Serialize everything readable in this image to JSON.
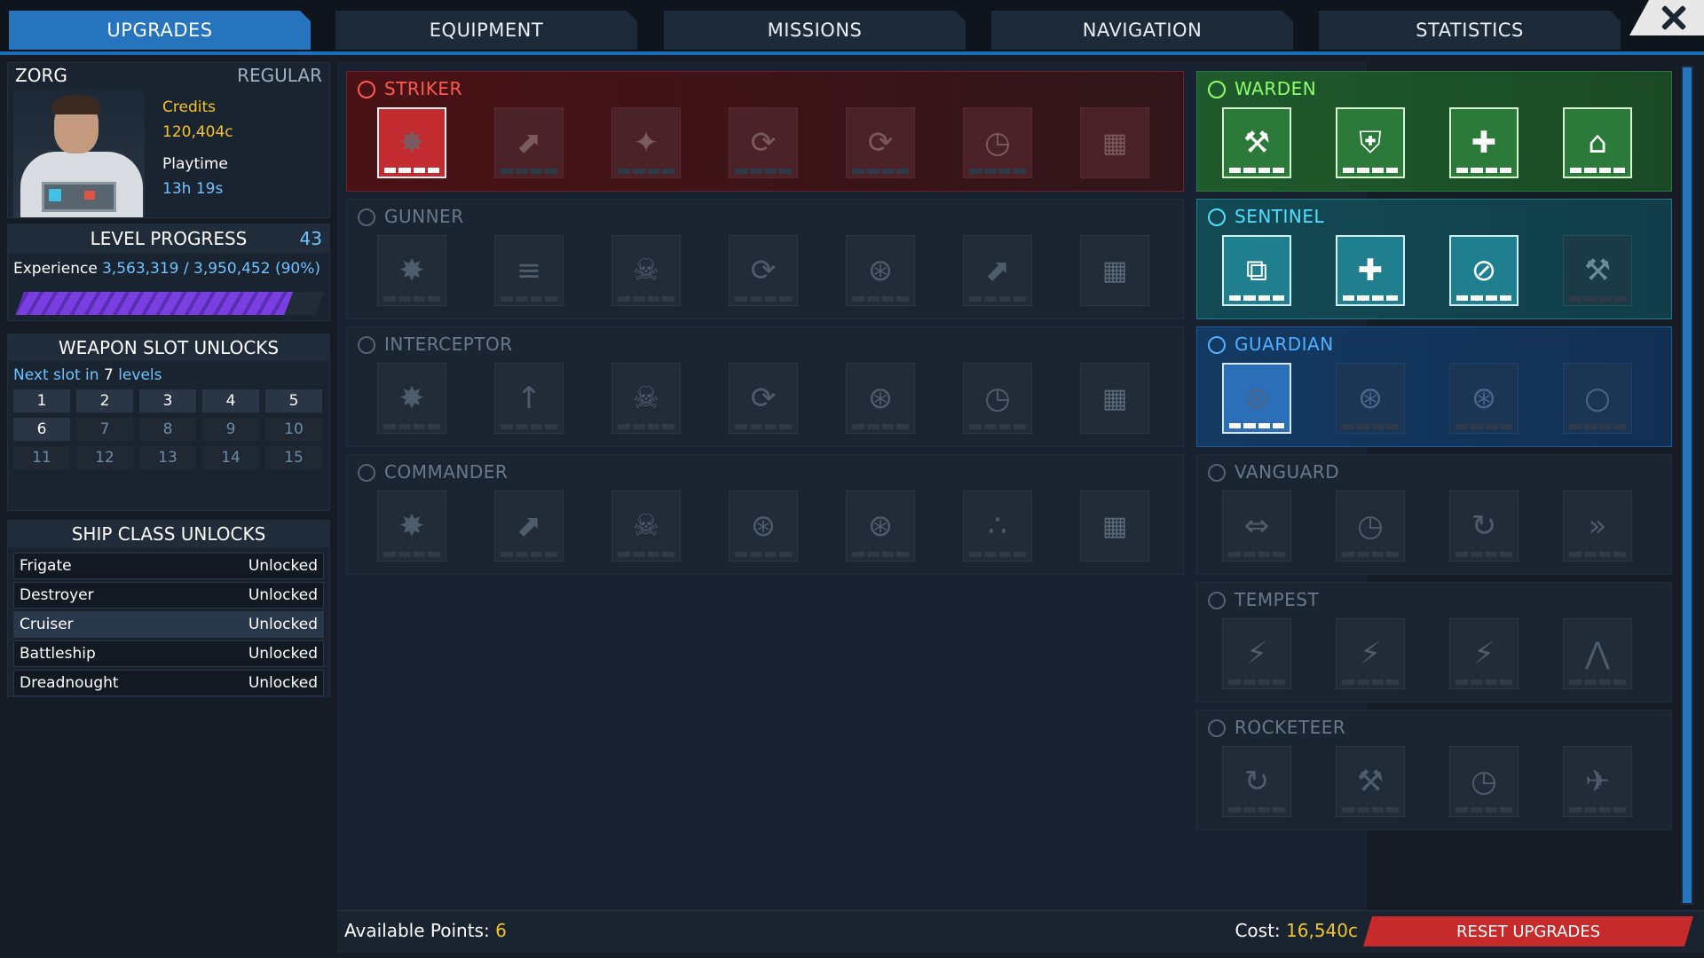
{
  "tabs": [
    "UPGRADES",
    "EQUIPMENT",
    "MISSIONS",
    "NAVIGATION",
    "STATISTICS"
  ],
  "profile": {
    "name": "ZORG",
    "rank": "REGULAR",
    "credits_label": "Credits",
    "credits_value": "120,404c",
    "playtime_label": "Playtime",
    "playtime_value": "13h 19s"
  },
  "level_progress": {
    "title": "LEVEL PROGRESS",
    "level": "43",
    "exp_label": "Experience",
    "exp_value": "3,563,319 / 3,950,452 (90%)",
    "percent": 90
  },
  "weapon_slots": {
    "title": "WEAPON SLOT UNLOCKS",
    "next_prefix": "Next slot in ",
    "next_value": "7",
    "next_suffix": " levels",
    "slots": [
      "1",
      "2",
      "3",
      "4",
      "5",
      "6",
      "7",
      "8",
      "9",
      "10",
      "11",
      "12",
      "13",
      "14",
      "15"
    ],
    "unlocked": 6
  },
  "ship_classes": {
    "title": "SHIP CLASS UNLOCKS",
    "items": [
      {
        "name": "Frigate",
        "status": "Unlocked"
      },
      {
        "name": "Destroyer",
        "status": "Unlocked"
      },
      {
        "name": "Cruiser",
        "status": "Unlocked"
      },
      {
        "name": "Battleship",
        "status": "Unlocked"
      },
      {
        "name": "Dreadnought",
        "status": "Unlocked"
      }
    ]
  },
  "trees_left": [
    {
      "title": "STRIKER",
      "theme": "red",
      "skills": [
        "✸",
        "⬈",
        "✦",
        "⟳",
        "⟳",
        "◷",
        "▦"
      ],
      "active": [
        0
      ]
    },
    {
      "title": "GUNNER",
      "theme": "gray",
      "skills": [
        "✸",
        "≡",
        "☠",
        "⟳",
        "⊛",
        "⬈",
        "▦"
      ],
      "active": []
    },
    {
      "title": "INTERCEPTOR",
      "theme": "gray",
      "skills": [
        "✸",
        "↑",
        "☠",
        "⟳",
        "⊛",
        "◷",
        "▦"
      ],
      "active": []
    },
    {
      "title": "COMMANDER",
      "theme": "gray",
      "skills": [
        "✸",
        "⬈",
        "☠",
        "⊛",
        "⊛",
        "∴",
        "▦"
      ],
      "active": []
    }
  ],
  "trees_right": [
    {
      "title": "WARDEN",
      "theme": "green",
      "skills": [
        "⚒",
        "⛨",
        "✚",
        "⌂"
      ],
      "active": [
        0,
        1,
        2,
        3
      ]
    },
    {
      "title": "SENTINEL",
      "theme": "teal",
      "skills": [
        "⧉",
        "✚",
        "⊘",
        "⚒"
      ],
      "active": [
        0,
        1,
        2
      ]
    },
    {
      "title": "GUARDIAN",
      "theme": "blue",
      "skills": [
        "⊛",
        "⊛",
        "⊛",
        "○"
      ],
      "active": [
        0
      ]
    },
    {
      "title": "VANGUARD",
      "theme": "gray",
      "skills": [
        "⇔",
        "◷",
        "↻",
        "»"
      ],
      "active": []
    },
    {
      "title": "TEMPEST",
      "theme": "gray",
      "skills": [
        "⚡",
        "⚡",
        "⚡",
        "⋀"
      ],
      "active": []
    },
    {
      "title": "ROCKETEER",
      "theme": "gray",
      "skills": [
        "↻",
        "⚒",
        "◷",
        "✈"
      ],
      "active": []
    }
  ],
  "bottom": {
    "available_label": "Available Points: ",
    "available_value": "6",
    "cost_label": "Cost: ",
    "cost_value": "16,540c",
    "reset_label": "RESET UPGRADES"
  }
}
